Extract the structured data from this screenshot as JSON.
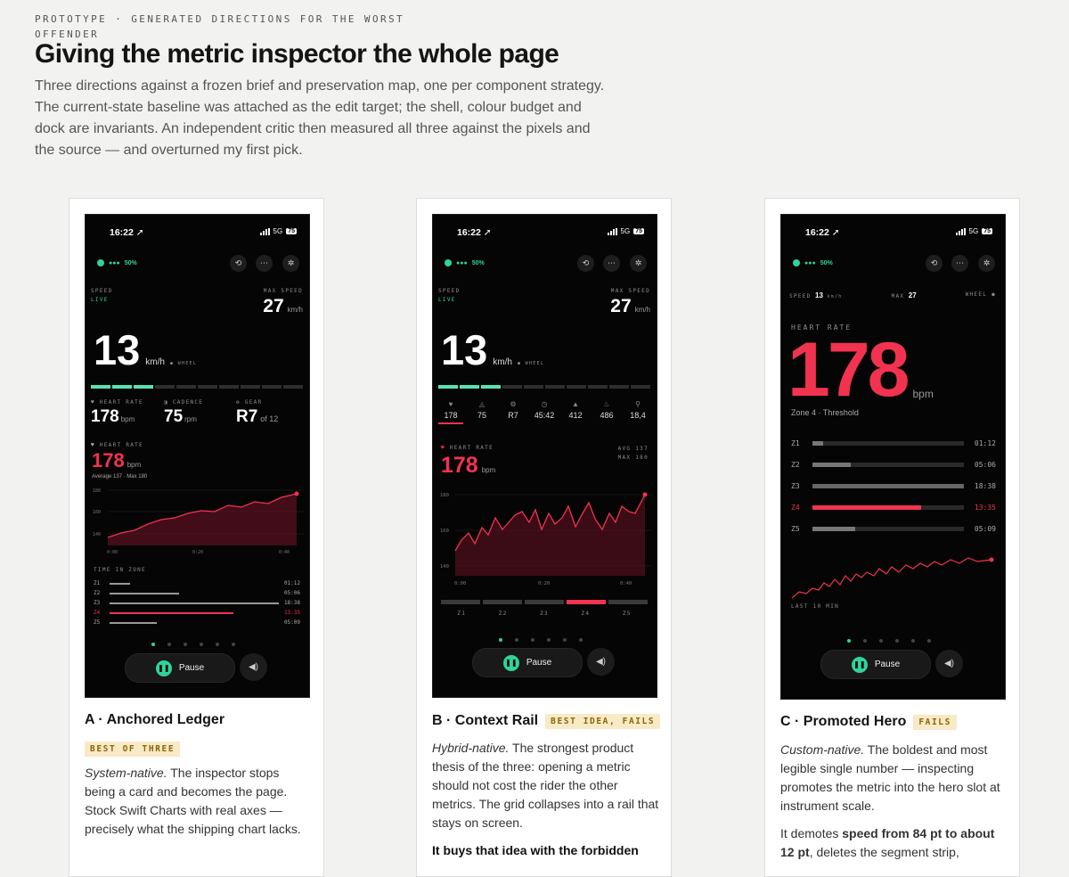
{
  "header": {
    "eyebrow": "PROTOTYPE · GENERATED DIRECTIONS FOR THE WORST OFFENDER",
    "title": "Giving the metric inspector the whole page",
    "lede": "Three directions against a frozen brief and preservation map, one per component strategy. The current-state baseline was attached as the edit target; the shell, colour budget and dock are invariants. An independent critic then measured all three against the pixels and the source — and overturned my first pick."
  },
  "phone": {
    "time": "16:22 ➚",
    "network": "5G",
    "battery": "75",
    "connection": "50%",
    "pause": "Pause"
  },
  "card_a": {
    "title": "A · Anchored Ledger",
    "badge": "BEST OF THREE",
    "body_em": "System-native.",
    "body": " The inspector stops being a card and becomes the page. Stock Swift Charts with real axes — precisely what the shipping chart lacks.",
    "speed_label": "SPEED",
    "live": "LIVE",
    "max_label": "MAX SPEED",
    "max_value": "27",
    "max_unit": "km/h",
    "speed": "13",
    "speed_unit": "km/h",
    "wheel": "● WHEEL",
    "hr_label": "HEART RATE",
    "hr_small": "178",
    "bpm": "bpm",
    "cad_label": "CADENCE",
    "cad": "75",
    "rpm": "rpm",
    "gear_label": "GEAR",
    "gear": "R7",
    "gear_of": "of 12",
    "hr_big_label": "HEART RATE",
    "hr_big": "178",
    "avg_max": "Average 137 · Max 180",
    "y_ticks": [
      "180",
      "160",
      "140"
    ],
    "x_ticks": [
      "0:00",
      "0:20",
      "0:40"
    ],
    "tiz_label": "TIME IN ZONE",
    "zones": [
      {
        "name": "Z1",
        "time": "01:12"
      },
      {
        "name": "Z2",
        "time": "05:06"
      },
      {
        "name": "Z3",
        "time": "18:38"
      },
      {
        "name": "Z4",
        "time": "13:35"
      },
      {
        "name": "Z5",
        "time": "05:09"
      }
    ]
  },
  "card_b": {
    "title": "B · Context Rail",
    "badge": "BEST IDEA, FAILS",
    "body_em": "Hybrid-native.",
    "body": " The strongest product thesis of the three: opening a metric should not cost the rider the other metrics. The grid collapses into a rail that stays on screen.",
    "body2": "It buys that idea with the forbidden",
    "speed_label": "SPEED",
    "live": "LIVE",
    "max_label": "MAX SPEED",
    "max_value": "27",
    "max_unit": "km/h",
    "speed": "13",
    "speed_unit": "km/h",
    "wheel": "● WHEEL",
    "rail": [
      "178",
      "75",
      "R7",
      "45:42",
      "412",
      "486",
      "18,4"
    ],
    "hr_label": "HEART RATE",
    "avg": "AVG 137",
    "max": "MAX 180",
    "hr_big": "178",
    "bpm": "bpm",
    "y_ticks": [
      "180",
      "160",
      "140"
    ],
    "x_ticks": [
      "0:00",
      "0:20",
      "0:40"
    ],
    "zone_names": [
      "Z1",
      "Z2",
      "Z3",
      "Z4",
      "Z5"
    ]
  },
  "card_c": {
    "title": "C · Promoted Hero",
    "badge": "FAILS",
    "body_em": "Custom-native.",
    "body": " The boldest and most legible single number — inspecting promotes the metric into the hero slot at instrument scale.",
    "body2_pre": "It demotes ",
    "body2_strong": "speed from 84 pt to about 12 pt",
    "body2_post": ", deletes the segment strip,",
    "speed_label": "SPEED",
    "speed": "13",
    "speed_unit": "km/h",
    "max_label": "MAX",
    "max_value": "27",
    "wheel": "WHEEL ●",
    "hr_label": "HEART RATE",
    "hr_big": "178",
    "bpm": "bpm",
    "zone_caption": "Zone 4 · Threshold",
    "zones": [
      {
        "name": "Z1",
        "time": "01:12"
      },
      {
        "name": "Z2",
        "time": "05:06"
      },
      {
        "name": "Z3",
        "time": "18:38"
      },
      {
        "name": "Z4",
        "time": "13:35"
      },
      {
        "name": "Z5",
        "time": "05:09"
      }
    ],
    "last": "LAST 10 MIN"
  }
}
